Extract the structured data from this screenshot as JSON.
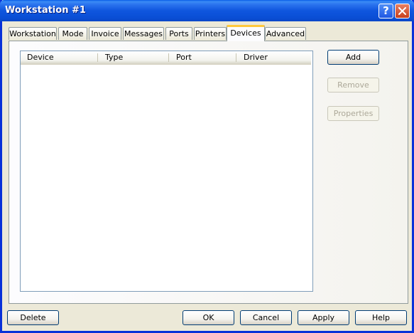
{
  "window": {
    "title": "Workstation #1"
  },
  "titlebar": {
    "help_label": "?"
  },
  "tabs": [
    {
      "label": "Workstation"
    },
    {
      "label": "Mode"
    },
    {
      "label": "Invoice"
    },
    {
      "label": "Messages"
    },
    {
      "label": "Ports"
    },
    {
      "label": "Printers"
    },
    {
      "label": "Devices",
      "active": true
    },
    {
      "label": "Advanced"
    }
  ],
  "devices_list": {
    "columns": [
      "Device",
      "Type",
      "Port",
      "Driver"
    ],
    "rows": []
  },
  "side_buttons": {
    "add": "Add",
    "remove": "Remove",
    "properties": "Properties"
  },
  "footer_buttons": {
    "delete": "Delete",
    "ok": "OK",
    "cancel": "Cancel",
    "apply": "Apply",
    "help": "Help"
  },
  "colors": {
    "titlebar": "#0a4fd6",
    "active_tab_accent": "#ffc83c",
    "button_border": "#003c74",
    "disabled_text": "#aca899"
  }
}
